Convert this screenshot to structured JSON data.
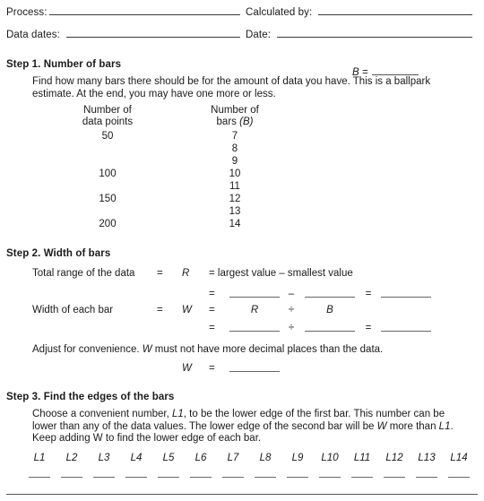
{
  "header": {
    "fields": [
      {
        "label": "Process:",
        "value": ""
      },
      {
        "label": "Calculated by:",
        "value": ""
      },
      {
        "label": "Data dates:",
        "value": ""
      },
      {
        "label": "Date:",
        "value": ""
      }
    ]
  },
  "step1": {
    "heading": "Step 1. Number of bars",
    "intro": "Find how many bars there should be for the amount of data you have. This is a ballpark estimate. At the end, you may have one more or less.",
    "col1_head_line1": "Number of",
    "col1_head_line2": "data points",
    "col2_head_line1": "Number of",
    "col2_head_line2": "bars",
    "col2_head_var": "(B)",
    "rows": [
      {
        "points": "50",
        "bars": "7"
      },
      {
        "points": "",
        "bars": "8"
      },
      {
        "points": "",
        "bars": "9"
      },
      {
        "points": "100",
        "bars": "10"
      },
      {
        "points": "",
        "bars": "11"
      },
      {
        "points": "150",
        "bars": "12"
      },
      {
        "points": "",
        "bars": "13"
      },
      {
        "points": "200",
        "bars": "14"
      }
    ],
    "b_result_label": "B =",
    "b_result_value": ""
  },
  "step2": {
    "heading": "Step 2. Width of bars",
    "row_range_label": "Total range of the data",
    "row_range_eq1": "=",
    "row_range_sym": "R",
    "row_range_eq2": "=",
    "row_range_text": "= largest value – smallest value",
    "range_calc_eq": "=",
    "range_calc_op": "–",
    "range_calc_eq2": "=",
    "range_a": "",
    "range_b": "",
    "range_c": "",
    "row_width_label": "Width of each bar",
    "row_width_eq1": "=",
    "row_width_sym": "W",
    "row_width_eq2": "=",
    "row_width_a": "R",
    "row_width_op": "÷",
    "row_width_b": "B",
    "width_calc_eq": "=",
    "width_calc_op": "÷",
    "width_calc_eq2": "=",
    "width_a": "",
    "width_b": "",
    "width_c": "",
    "adjust_note_pre": "Adjust for convenience. ",
    "adjust_note_var": "W",
    "adjust_note_post": " must not have more decimal places than the data.",
    "w_final_sym": "W",
    "w_final_eq": "=",
    "w_final_value": ""
  },
  "step3": {
    "heading": "Step 3. Find the edges of the bars",
    "para_1": "Choose a convenient number, ",
    "para_var1": "L1",
    "para_2": ", to be the lower edge of the first bar. This number can be lower than any of the data values. The lower edge of the second bar will be ",
    "para_var2": "W",
    "para_3": " more than ",
    "para_var3": "L1",
    "para_4": ". Keep adding W to find the lower edge of each bar.",
    "edge_labels": [
      "L1",
      "L2",
      "L3",
      "L4",
      "L5",
      "L6",
      "L7",
      "L8",
      "L9",
      "L10",
      "L11",
      "L12",
      "L13",
      "L14"
    ],
    "edge_values": [
      "",
      "",
      "",
      "",
      "",
      "",
      "",
      "",
      "",
      "",
      "",
      "",
      "",
      ""
    ]
  },
  "colors": {
    "text": "#1a1a1a",
    "rule": "#3a3a3a",
    "blank_rule": "#666666",
    "background": "#ffffff"
  }
}
